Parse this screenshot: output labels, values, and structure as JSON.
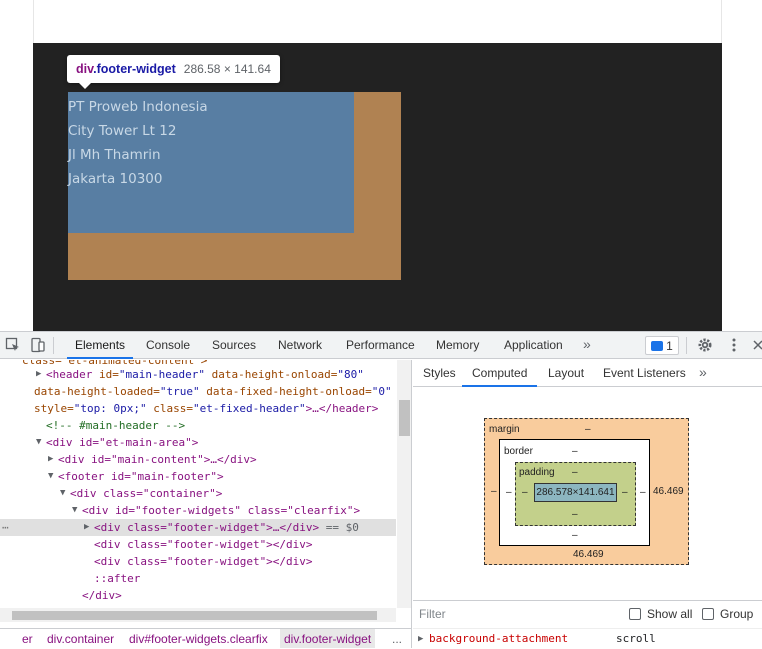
{
  "page": {
    "address_lines": [
      "PT Proweb Indonesia",
      "City Tower Lt 12",
      "Jl Mh Thamrin",
      "Jakarta 10300"
    ],
    "tooltip": {
      "tag": "div",
      "class": ".footer-widget",
      "size": "286.58 × 141.64"
    }
  },
  "devtools": {
    "tabs": [
      "Elements",
      "Console",
      "Sources",
      "Network",
      "Performance",
      "Memory",
      "Application"
    ],
    "active_tab": "Elements",
    "more": "»",
    "issues_count": "1",
    "dom": {
      "top_cut": "class=\"et-animated-content\">",
      "header_open": "<header",
      "header_attr1": "id=",
      "header_val1": "\"main-header\"",
      "header_attr2": "data-height-onload=",
      "header_val2": "\"80\"",
      "header2_attr1": "data-height-loaded=",
      "header2_val1": "\"true\"",
      "header2_attr2": "data-fixed-height-onload=",
      "header2_val2": "\"0\"",
      "header3_attr1": "style=",
      "header3_val1": "\"top: 0px;\"",
      "header3_attr2": "class=",
      "header3_val2": "\"et-fixed-header\"",
      "header3_close": ">…</header>",
      "comment": "<!-- #main-header -->",
      "main_area": "<div id=\"et-main-area\">",
      "main_content": "<div id=\"main-content\">…</div>",
      "footer": "<footer id=\"main-footer\">",
      "container": "<div class=\"container\">",
      "widgets": "<div id=\"footer-widgets\" class=\"clearfix\">",
      "widget_sel": "<div class=\"footer-widget\">…</div>",
      "eq0": "== $0",
      "widget2": "<div class=\"footer-widget\"></div>",
      "widget3": "<div class=\"footer-widget\"></div>",
      "after": "::after",
      "close_div": "</div>"
    },
    "breadcrumbs": [
      "er",
      "div.container",
      "div#footer-widgets.clearfix",
      "div.footer-widget",
      "..."
    ],
    "styles_tabs": [
      "Styles",
      "Computed",
      "Layout",
      "Event Listeners"
    ],
    "styles_active": "Computed",
    "box_model": {
      "margin_label": "margin",
      "margin_top": "–",
      "margin_left": "–",
      "margin_right": "46.469",
      "margin_bottom": "46.469",
      "border_label": "border",
      "border_top": "–",
      "border_left": "–",
      "border_right": "–",
      "border_bottom": "–",
      "padding_label": "padding",
      "padding_top": "–",
      "padding_left": "–",
      "padding_right": "–",
      "padding_bottom": "–",
      "content": "286.578×141.641"
    },
    "filter_placeholder": "Filter",
    "show_all": "Show all",
    "group": "Group",
    "property": {
      "name": "background-attachment",
      "value": "scroll"
    }
  }
}
